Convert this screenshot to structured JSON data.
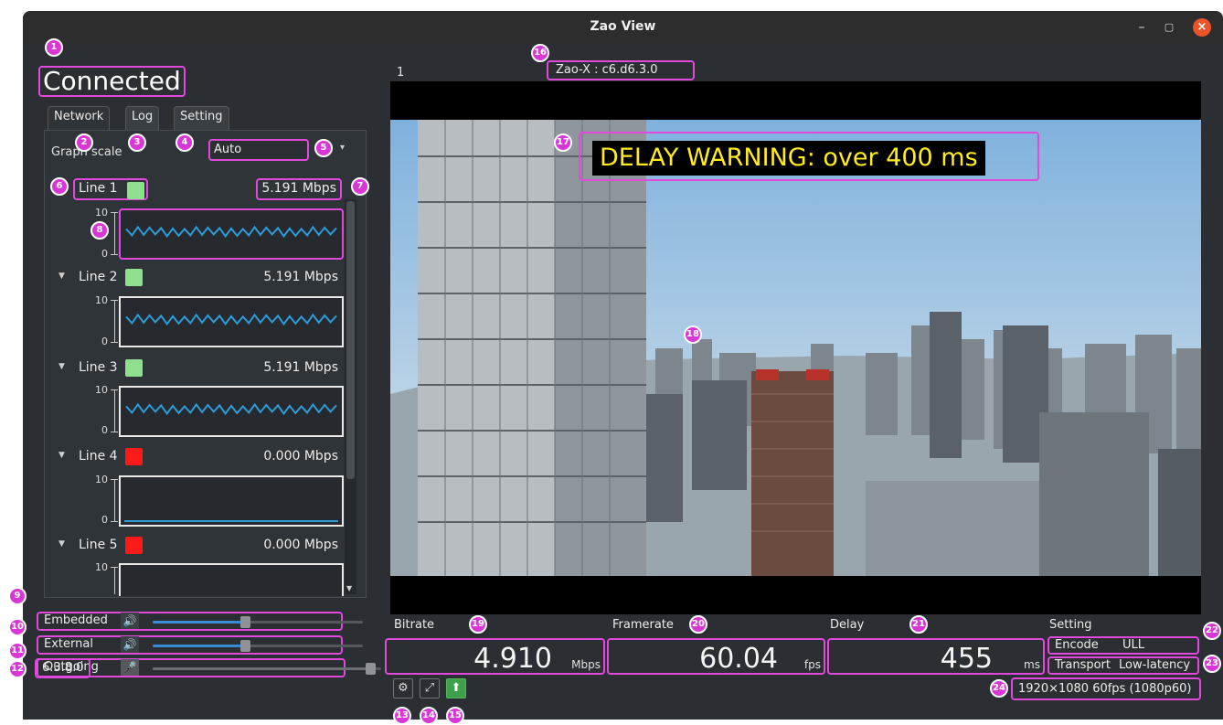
{
  "window": {
    "title": "Zao View",
    "controls": {
      "minimize": "–",
      "maximize": "▢",
      "close": "×"
    }
  },
  "status": "Connected",
  "tabs": [
    {
      "label": "Network",
      "active": true
    },
    {
      "label": "Log",
      "active": false
    },
    {
      "label": "Setting",
      "active": false
    }
  ],
  "graph_scale": {
    "label": "Graph scale",
    "value": "Auto",
    "arrow": "▾"
  },
  "lines": [
    {
      "name": "Line 1",
      "color": "#8ee08e",
      "rate": "5.191 Mbps",
      "y_max": "10",
      "y_min": "0",
      "signal": "active"
    },
    {
      "name": "Line 2",
      "color": "#8ee08e",
      "rate": "5.191 Mbps",
      "y_max": "10",
      "y_min": "0",
      "signal": "active"
    },
    {
      "name": "Line 3",
      "color": "#8ee08e",
      "rate": "5.191 Mbps",
      "y_max": "10",
      "y_min": "0",
      "signal": "active"
    },
    {
      "name": "Line 4",
      "color": "#ff1a1a",
      "rate": "0.000 Mbps",
      "y_max": "10",
      "y_min": "0",
      "signal": "flat"
    },
    {
      "name": "Line 5",
      "color": "#ff1a1a",
      "rate": "0.000 Mbps",
      "y_max": "10",
      "y_min": "",
      "signal": "flat"
    }
  ],
  "audio": [
    {
      "label": "Embedded",
      "icon": "🔊",
      "level": 0.44,
      "muted": false
    },
    {
      "label": "External",
      "icon": "🔊",
      "level": 0.44,
      "muted": false
    },
    {
      "label": "Outgoing",
      "icon": "🎤",
      "level": 0.95,
      "muted": true
    }
  ],
  "version": "6.3.8.0",
  "video": {
    "index": "1",
    "device": "Zao-X : c6.d6.3.0",
    "warning": "DELAY WARNING: over 400 ms"
  },
  "metrics": {
    "bitrate": {
      "label": "Bitrate",
      "value": "4.910",
      "unit": "Mbps"
    },
    "framerate": {
      "label": "Framerate",
      "value": "60.04",
      "unit": "fps"
    },
    "delay": {
      "label": "Delay",
      "value": "455",
      "unit": "ms"
    }
  },
  "setting": {
    "label": "Setting",
    "encode": {
      "key": "Encode",
      "value": "ULL"
    },
    "transport": {
      "key": "Transport",
      "value": "Low-latency"
    },
    "resolution": "1920×1080  60fps (1080p60)"
  },
  "toolbar": {
    "settings_icon": "⚙",
    "fullscreen_icon": "⤢",
    "upload_icon": "⬆"
  },
  "callouts": [
    "1",
    "2",
    "3",
    "4",
    "5",
    "6",
    "7",
    "8",
    "9",
    "10",
    "11",
    "12",
    "13",
    "14",
    "15",
    "16",
    "17",
    "18",
    "19",
    "20",
    "21",
    "22",
    "23",
    "24"
  ],
  "colors": {
    "highlight": "#e049dc",
    "graph_line": "#2f9bd8",
    "warning_text": "#ffeb1e",
    "window_bg": "#2b2f33"
  }
}
